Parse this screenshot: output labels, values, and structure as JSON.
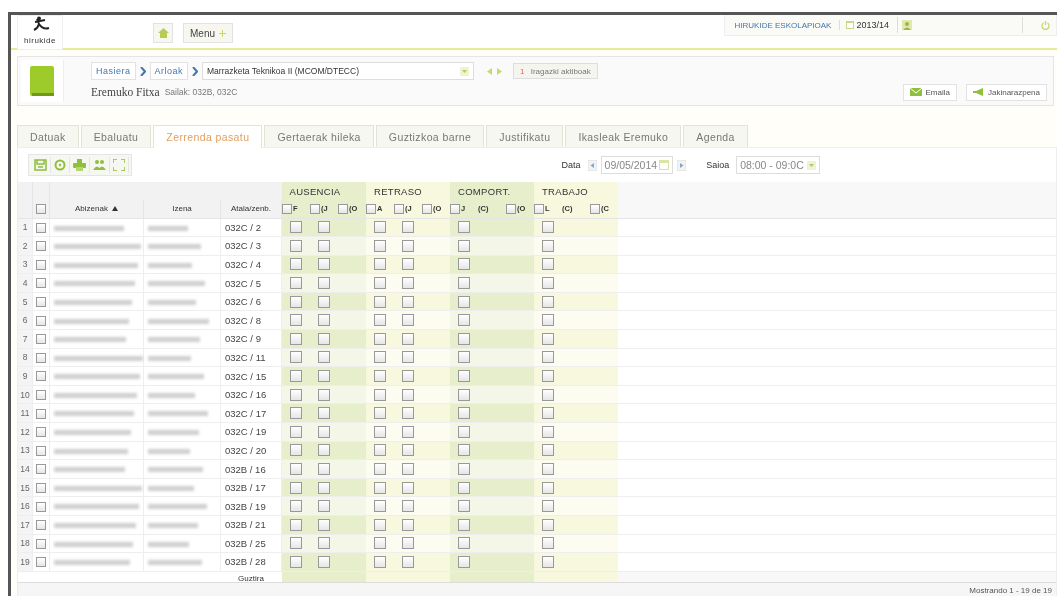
{
  "header": {
    "logo_text": "hirukide",
    "menu_button": "Menu",
    "school": "HIRUKIDE ESKOLAPIOAK",
    "year": "2013/14"
  },
  "breadcrumb": {
    "items": [
      "Hasiera",
      "Arloak"
    ],
    "subject": "Marrazketa Teknikoa II (MCOM/DTECC)",
    "filters_count": "1",
    "filters_label": "Iragazki aktiboak",
    "page_title": "Eremuko Fitxa",
    "sections": "Sailak: 032B, 032C",
    "actions": [
      {
        "kind": "mail",
        "label": "Emaila"
      },
      {
        "kind": "notify",
        "label": "Jakinarazpena"
      }
    ]
  },
  "tabs": [
    {
      "label": "Datuak",
      "selected": false
    },
    {
      "label": "Ebaluatu",
      "selected": false
    },
    {
      "label": "Zerrenda pasatu",
      "selected": true
    },
    {
      "label": "Gertaerak hileka",
      "selected": false
    },
    {
      "label": "Guztizkoa barne",
      "selected": false
    },
    {
      "label": "Justifikatu",
      "selected": false
    },
    {
      "label": "Ikasleak Eremuko",
      "selected": false
    },
    {
      "label": "Agenda",
      "selected": false
    }
  ],
  "toolbar": {
    "date_label": "Data",
    "date": "09/05/2014",
    "session_label": "Saioa",
    "session": "08:00 - 09:0C"
  },
  "table": {
    "select_all_checked": false,
    "columns": [
      {
        "label": "Abizenak",
        "sorted": true
      },
      {
        "label": "Izena"
      },
      {
        "label": "Atala/zenb."
      }
    ],
    "groups": [
      {
        "label": "AUSENCIA",
        "color": "#e6eecb",
        "columns": [
          {
            "label": "F",
            "header_check": false,
            "kind": "check"
          },
          {
            "label": "(J",
            "header_check": false,
            "kind": "check"
          },
          {
            "label": "(O",
            "header_check": false,
            "kind": "blank"
          }
        ]
      },
      {
        "label": "RETRASO",
        "color": "#f8f8df",
        "columns": [
          {
            "label": "A",
            "header_check": false,
            "kind": "check"
          },
          {
            "label": "(J",
            "header_check": false,
            "kind": "check"
          },
          {
            "label": "(O",
            "header_check": false,
            "kind": "blank"
          }
        ]
      },
      {
        "label": "COMPORT.",
        "color": "#e6eecb",
        "columns": [
          {
            "label": "J",
            "header_check": false,
            "kind": "check"
          },
          {
            "label": "(C)",
            "kind": "blank"
          },
          {
            "label": "(O",
            "header_check": false,
            "kind": "blank"
          }
        ]
      },
      {
        "label": "TRABAJO",
        "color": "#f8f8df",
        "columns": [
          {
            "label": "L",
            "header_check": false,
            "kind": "check"
          },
          {
            "label": "(C)",
            "kind": "blank"
          },
          {
            "label": "(C",
            "header_check": false,
            "kind": "blank"
          }
        ]
      }
    ],
    "rows": [
      {
        "n": "1",
        "code": "032C / 2",
        "selected": false,
        "checks": [
          false,
          false,
          false,
          false,
          false,
          false
        ]
      },
      {
        "n": "2",
        "code": "032C / 3",
        "selected": false,
        "checks": [
          false,
          false,
          false,
          false,
          false,
          false
        ]
      },
      {
        "n": "3",
        "code": "032C / 4",
        "selected": false,
        "checks": [
          false,
          false,
          false,
          false,
          false,
          false
        ]
      },
      {
        "n": "4",
        "code": "032C / 5",
        "selected": false,
        "checks": [
          false,
          false,
          false,
          false,
          false,
          false
        ]
      },
      {
        "n": "5",
        "code": "032C / 6",
        "selected": false,
        "checks": [
          false,
          false,
          false,
          false,
          false,
          false
        ]
      },
      {
        "n": "6",
        "code": "032C / 8",
        "selected": false,
        "checks": [
          false,
          false,
          false,
          false,
          false,
          false
        ]
      },
      {
        "n": "7",
        "code": "032C / 9",
        "selected": false,
        "checks": [
          false,
          false,
          false,
          false,
          false,
          false
        ]
      },
      {
        "n": "8",
        "code": "032C / 11",
        "selected": false,
        "checks": [
          false,
          false,
          false,
          false,
          false,
          false
        ]
      },
      {
        "n": "9",
        "code": "032C / 15",
        "selected": false,
        "checks": [
          false,
          false,
          false,
          false,
          false,
          false
        ]
      },
      {
        "n": "10",
        "code": "032C / 16",
        "selected": false,
        "checks": [
          false,
          false,
          false,
          false,
          false,
          false
        ]
      },
      {
        "n": "11",
        "code": "032C / 17",
        "selected": false,
        "checks": [
          false,
          false,
          false,
          false,
          false,
          false
        ]
      },
      {
        "n": "12",
        "code": "032C / 19",
        "selected": false,
        "checks": [
          false,
          false,
          false,
          false,
          false,
          false
        ]
      },
      {
        "n": "13",
        "code": "032C / 20",
        "selected": false,
        "checks": [
          false,
          false,
          false,
          false,
          false,
          false
        ]
      },
      {
        "n": "14",
        "code": "032B / 16",
        "selected": false,
        "checks": [
          false,
          false,
          false,
          false,
          false,
          false
        ]
      },
      {
        "n": "15",
        "code": "032B / 17",
        "selected": false,
        "checks": [
          false,
          false,
          false,
          false,
          false,
          false
        ]
      },
      {
        "n": "16",
        "code": "032B / 19",
        "selected": false,
        "checks": [
          false,
          false,
          false,
          false,
          false,
          false
        ]
      },
      {
        "n": "17",
        "code": "032B / 21",
        "selected": false,
        "checks": [
          false,
          false,
          false,
          false,
          false,
          false
        ]
      },
      {
        "n": "18",
        "code": "032B / 25",
        "selected": false,
        "checks": [
          false,
          false,
          false,
          false,
          false,
          false
        ]
      },
      {
        "n": "19",
        "code": "032B / 28",
        "selected": false,
        "checks": [
          false,
          false,
          false,
          false,
          false,
          false
        ]
      }
    ],
    "total_label": "Guztira"
  },
  "status": "Mostrando 1 - 19 de 19"
}
